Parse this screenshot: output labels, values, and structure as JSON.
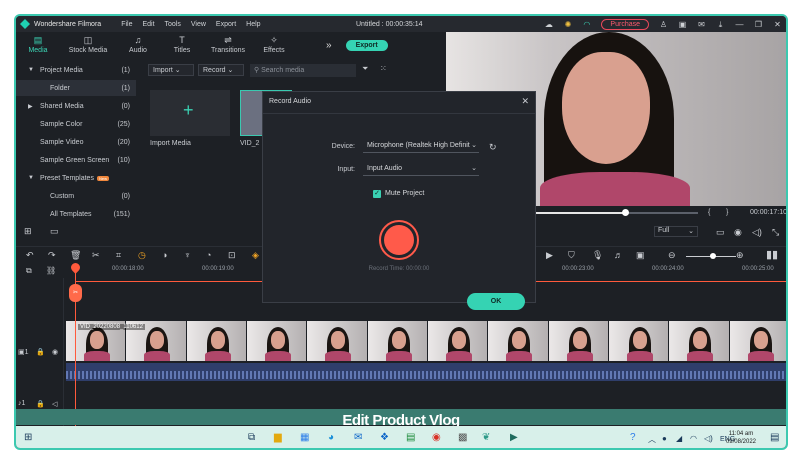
{
  "app": {
    "name": "Wondershare Filmora",
    "window_title": "Untitled : 00:00:35:14",
    "purchase_label": "Purchase",
    "menus": [
      "File",
      "Edit",
      "Tools",
      "View",
      "Export",
      "Help"
    ]
  },
  "toolbar": {
    "tabs": [
      {
        "label": "Media",
        "icon": "folder-icon",
        "active": true
      },
      {
        "label": "Stock Media",
        "icon": "stock-icon"
      },
      {
        "label": "Audio",
        "icon": "music-icon"
      },
      {
        "label": "Titles",
        "icon": "titles-icon"
      },
      {
        "label": "Transitions",
        "icon": "transitions-icon"
      },
      {
        "label": "Effects",
        "icon": "effects-icon"
      }
    ],
    "export_label": "Export"
  },
  "sidebar": {
    "items": [
      {
        "label": "Project Media",
        "count": "(1)"
      },
      {
        "label": "Folder",
        "count": "(1)"
      },
      {
        "label": "Shared Media",
        "count": "(0)"
      },
      {
        "label": "Sample Color",
        "count": "(25)"
      },
      {
        "label": "Sample Video",
        "count": "(20)"
      },
      {
        "label": "Sample Green Screen",
        "count": "(10)"
      },
      {
        "label": "Preset Templates",
        "count": ""
      },
      {
        "label": "Custom",
        "count": "(0)"
      },
      {
        "label": "All Templates",
        "count": "(151)"
      }
    ],
    "new_badge": "New"
  },
  "media": {
    "import_tab": "Import",
    "record_tab": "Record",
    "search_placeholder": "Search media",
    "import_label": "Import Media",
    "vid_label": "VID_2"
  },
  "player": {
    "time": "00:00:17:10",
    "quality": "Full",
    "progress": 0.56
  },
  "ruler": {
    "ticks": [
      "00:00:18:00",
      "00:00:19:00",
      "00:00:23:00",
      "00:00:24:00",
      "00:00:25:00"
    ]
  },
  "timeline": {
    "clip_label": "VID_20220808_110612"
  },
  "caption": "Edit Product Vlog",
  "dialog": {
    "title": "Record Audio",
    "device_label": "Device:",
    "device_value": "Microphone (Realtek High Definit",
    "input_label": "Input:",
    "input_value": "Input Audio",
    "mute_label": "Mute Project",
    "record_time": "Record Time: 00:00:00",
    "ok_label": "OK"
  },
  "taskbar": {
    "lang": "ENG",
    "time": "11:04 am",
    "date": "09/08/2022"
  }
}
